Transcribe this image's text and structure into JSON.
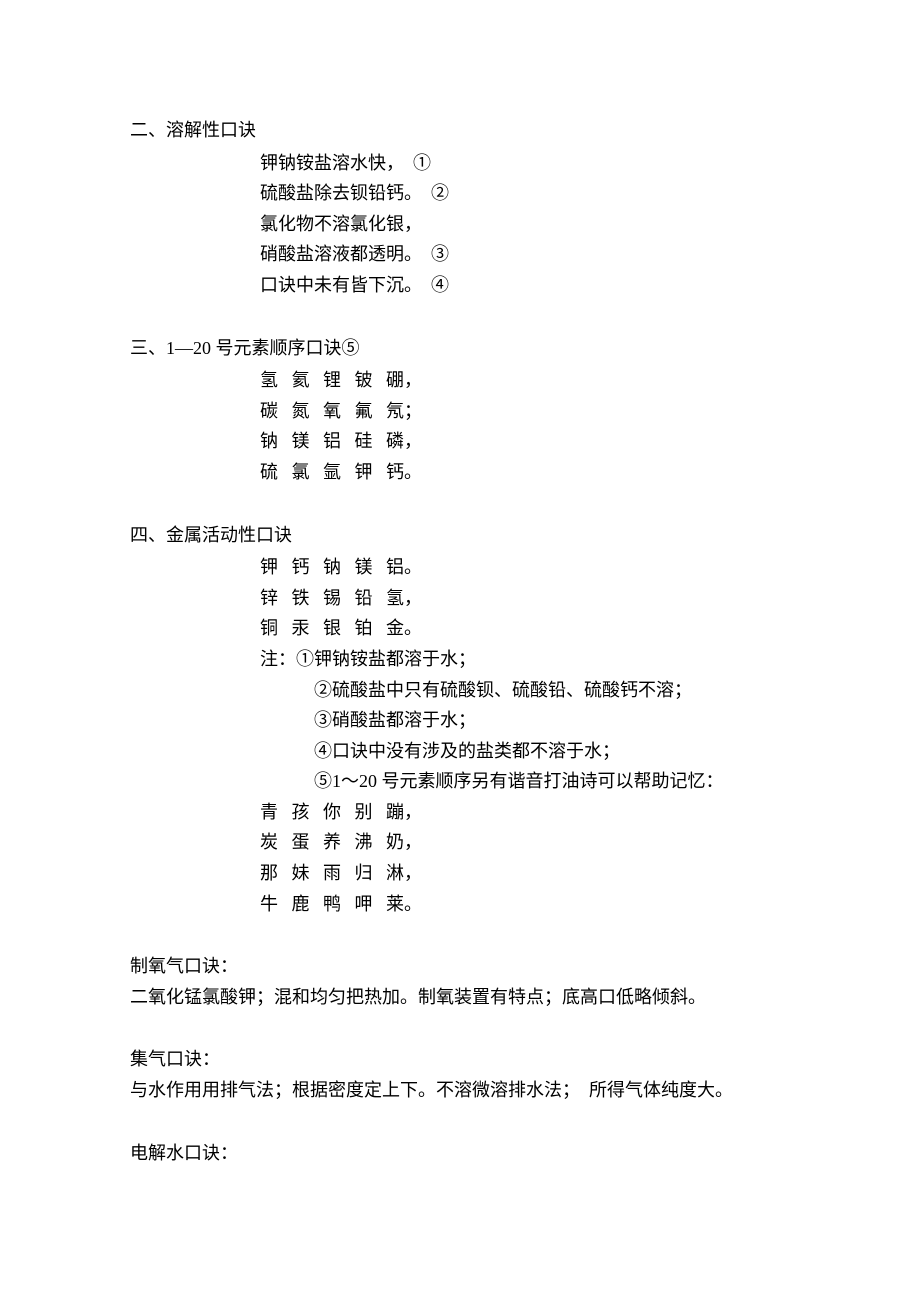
{
  "sections": {
    "s2": {
      "title": "二、溶解性口诀",
      "lines": [
        "钾钠铵盐溶水快，  ①",
        "硫酸盐除去钡铅钙。  ②",
        "氯化物不溶氯化银，",
        "硝酸盐溶液都透明。  ③",
        "口诀中未有皆下沉。  ④"
      ]
    },
    "s3": {
      "title": "三、1—20 号元素顺序口诀⑤",
      "lines": [
        "氢   氦   锂   铍   硼，",
        "碳   氮   氧   氟   氖；",
        "钠   镁   铝   硅   磷，",
        "硫   氯   氩   钾   钙。"
      ]
    },
    "s4": {
      "title": "四、金属活动性口诀",
      "lines": [
        "钾   钙   钠   镁   铝。",
        "锌   铁   锡   铅   氢，",
        "铜   汞   银   铂   金。"
      ],
      "note_head": "注：①钾钠铵盐都溶于水；",
      "notes": [
        "②硫酸盐中只有硫酸钡、硫酸铅、硫酸钙不溶；",
        "③硝酸盐都溶于水；",
        "④口诀中没有涉及的盐类都不溶于水；",
        "⑤1～20 号元素顺序另有谐音打油诗可以帮助记忆："
      ],
      "poem": [
        "青   孩   你   别   蹦，",
        "炭   蛋   养   沸   奶，",
        "那   妹   雨   归   淋，",
        "牛   鹿   鸭   呷   莱。"
      ]
    },
    "o2": {
      "title": "制氧气口诀：",
      "text": "二氧化锰氯酸钾；混和均匀把热加。制氧装置有特点；底高口低略倾斜。"
    },
    "gas": {
      "title": "集气口诀：",
      "text": "与水作用用排气法；根据密度定上下。不溶微溶排水法；  所得气体纯度大。"
    },
    "water": {
      "title": "电解水口诀："
    }
  }
}
